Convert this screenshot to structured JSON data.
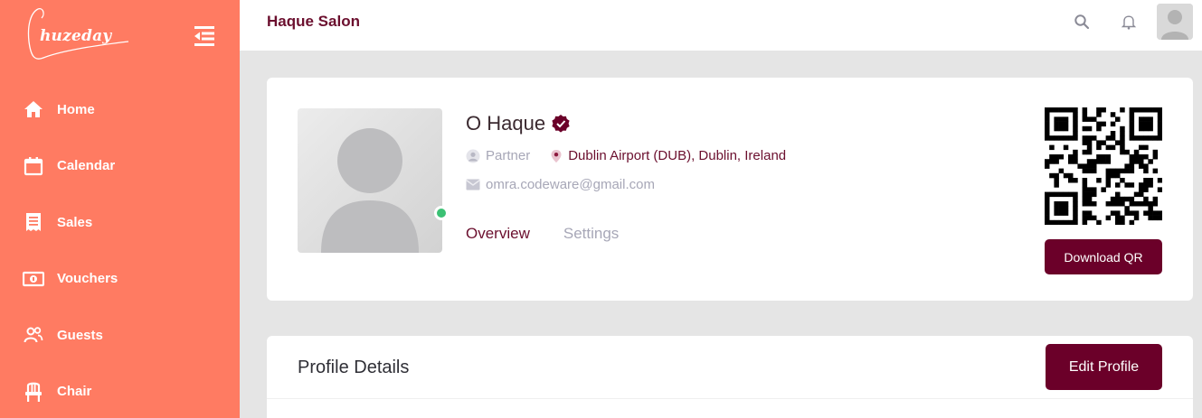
{
  "sidebar": {
    "logo_text": "huzeday",
    "items": [
      {
        "label": "Home",
        "icon": "home-icon"
      },
      {
        "label": "Calendar",
        "icon": "calendar-icon"
      },
      {
        "label": "Sales",
        "icon": "receipt-icon"
      },
      {
        "label": "Vouchers",
        "icon": "money-icon"
      },
      {
        "label": "Guests",
        "icon": "users-icon"
      },
      {
        "label": "Chair",
        "icon": "chair-icon"
      }
    ]
  },
  "header": {
    "title": "Haque Salon"
  },
  "profile": {
    "name": "O Haque",
    "role": "Partner",
    "location": "Dublin Airport (DUB), Dublin, Ireland",
    "email": "omra.codeware@gmail.com",
    "online": true,
    "tabs": [
      {
        "label": "Overview",
        "active": true
      },
      {
        "label": "Settings",
        "active": false
      }
    ],
    "download_qr_label": "Download QR"
  },
  "details": {
    "title": "Profile Details",
    "edit_label": "Edit Profile"
  },
  "colors": {
    "sidebar_bg": "#ff7b62",
    "brand": "#6b0029",
    "accent_text": "#6b0f2e",
    "online": "#3bc174"
  }
}
